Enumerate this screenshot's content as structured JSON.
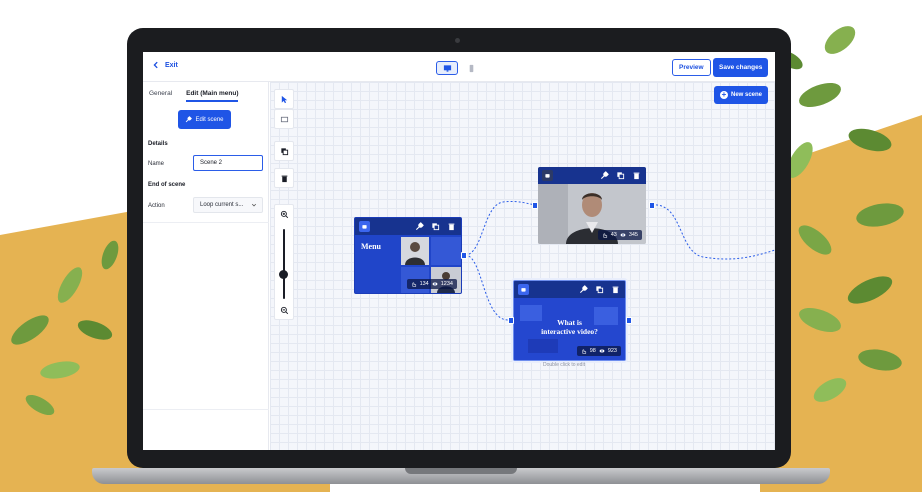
{
  "topbar": {
    "exit_label": "Exit",
    "preview_label": "Preview",
    "save_label": "Save changes"
  },
  "sidebar": {
    "tabs": [
      {
        "label": "General"
      },
      {
        "label": "Edit (Main menu)"
      }
    ],
    "edit_scene_label": "Edit scene",
    "details_heading": "Details",
    "name_label": "Name",
    "name_value": "Scene 2",
    "end_heading": "End of scene",
    "action_label": "Action",
    "action_value": "Loop current s..."
  },
  "canvas": {
    "new_scene_label": "New scene",
    "hint": "Double click to edit"
  },
  "scenes": {
    "menu": {
      "title": "Menu",
      "clicks": "134",
      "views": "1234"
    },
    "top": {
      "clicks": "43",
      "views": "345"
    },
    "bottom": {
      "title_line1": "What is",
      "title_line2": "interactive video?",
      "clicks": "98",
      "views": "923"
    }
  },
  "colors": {
    "accent": "#1f55e6",
    "scene_bg": "#2045c9",
    "background_tan": "#e5b352"
  }
}
